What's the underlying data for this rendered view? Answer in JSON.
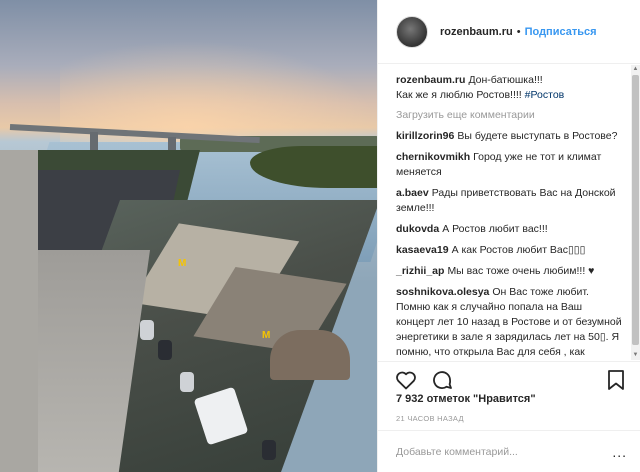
{
  "post": {
    "username": "rozenbaum.ru",
    "separator": "•",
    "follow_label": "Подписаться"
  },
  "caption": {
    "author": "rozenbaum.ru",
    "text_line1": "Дон-батюшка!!!",
    "text_line2": "Как же я люблю Ростов!!!!",
    "hashtag": "#Ростов"
  },
  "load_more_label": "Загрузить еще комментарии",
  "comments": [
    {
      "author": "kirillzorin96",
      "text": "Вы будете выступать в Ростове?"
    },
    {
      "author": "chernikovmikh",
      "text": "Город уже не тот и климат меняется"
    },
    {
      "author": "a.baev",
      "text": "Рады приветствовать Вас на Донской земле!!!"
    },
    {
      "author": "dukovda",
      "text": "А Ростов любит вас!!!"
    },
    {
      "author": "kasaeva19",
      "text": "А как Ростов любит Вас▯▯▯"
    },
    {
      "author": "_rizhii_ap",
      "text": "Мы вас тоже очень любим!!! ♥"
    },
    {
      "author": "soshnikova.olesya",
      "text": "Он Вас тоже любит. Помню как я случайно попала на Ваш концерт лет 10 назад в Ростове и от безумной энергетики в зале я зарядилась лет на 50▯. Я помню, что открыла Вас для себя , как Настоящего человека▯▯"
    }
  ],
  "likes_label": "7 932 отметок \"Нравится\"",
  "time_label": "21 ЧАСОВ НАЗАД",
  "add_comment_placeholder": "Добавьте комментарий...",
  "more_label": "...",
  "icons": {
    "like": "heart-icon",
    "comment": "comment-icon",
    "save": "bookmark-icon"
  },
  "colors": {
    "link": "#3897f0",
    "text": "#262626",
    "muted": "#999999"
  }
}
